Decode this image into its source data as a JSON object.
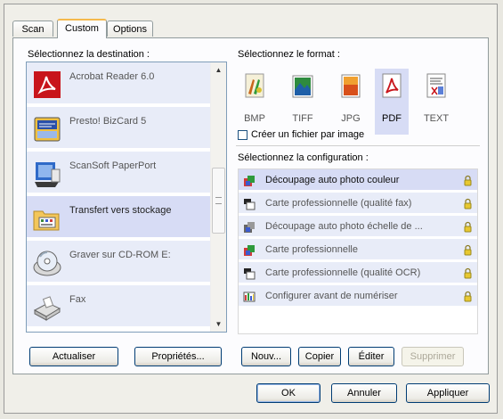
{
  "tabs": [
    {
      "label": "Scan"
    },
    {
      "label": "Custom"
    },
    {
      "label": "Options"
    }
  ],
  "destination": {
    "heading": "Sélectionnez la destination :",
    "items": [
      {
        "label": "Acrobat Reader 6.0",
        "icon": "acrobat-icon"
      },
      {
        "label": "Presto! BizCard 5",
        "icon": "bizcard-icon"
      },
      {
        "label": "ScanSoft PaperPort",
        "icon": "paperport-icon"
      },
      {
        "label": "Transfert vers stockage",
        "icon": "storage-folder-icon",
        "selected": true
      },
      {
        "label": "Graver sur CD-ROM  E:",
        "icon": "cd-burn-icon"
      },
      {
        "label": "Fax",
        "icon": "fax-icon"
      }
    ]
  },
  "format": {
    "heading": "Sélectionnez le format :",
    "items": [
      {
        "label": "BMP",
        "icon": "bmp-icon"
      },
      {
        "label": "TIFF",
        "icon": "tiff-icon"
      },
      {
        "label": "JPG",
        "icon": "jpg-icon"
      },
      {
        "label": "PDF",
        "icon": "pdf-icon",
        "selected": true
      },
      {
        "label": "TEXT",
        "icon": "text-icon"
      }
    ],
    "checkbox_label": "Créer un fichier par image"
  },
  "configuration": {
    "heading": "Sélectionnez la configuration :",
    "items": [
      {
        "label": "Découpage auto photo couleur",
        "icon": "color-photo-icon",
        "selected": true
      },
      {
        "label": "Carte professionnelle (qualité fax)",
        "icon": "bw-card-icon"
      },
      {
        "label": "Découpage auto photo échelle de ...",
        "icon": "gray-photo-icon"
      },
      {
        "label": "Carte professionnelle",
        "icon": "color-card-icon"
      },
      {
        "label": "Carte professionnelle (qualité OCR)",
        "icon": "bw-card-icon"
      },
      {
        "label": "Configurer avant de numériser",
        "icon": "configure-icon"
      }
    ]
  },
  "buttons": {
    "actualiser": "Actualiser",
    "proprietes": "Propriétés...",
    "nouveau": "Nouv...",
    "copier": "Copier",
    "editer": "Éditer",
    "supprimer": "Supprimer",
    "ok": "OK",
    "annuler": "Annuler",
    "appliquer": "Appliquer"
  },
  "colors": {
    "selection": "#d7dcf5",
    "item_background": "#e8ecf8",
    "tab_highlight": "#f5b94d"
  }
}
